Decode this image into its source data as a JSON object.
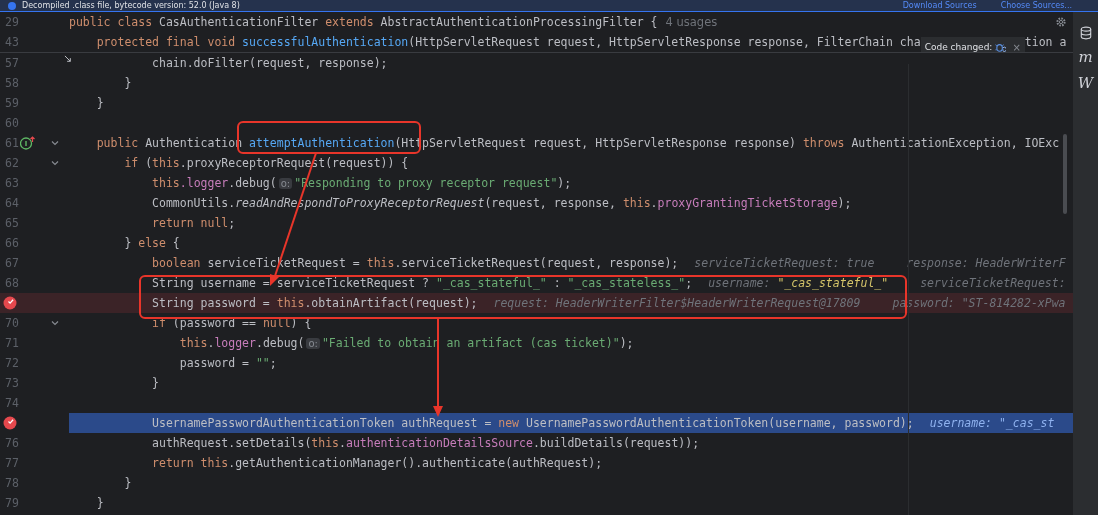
{
  "banner": {
    "text": "Decompiled .class file, bytecode version: 52.0 (Java 8)",
    "links": [
      "Download Sources",
      "Choose Sources..."
    ]
  },
  "side_tools": [
    {
      "kind": "database"
    },
    {
      "kind": "letter",
      "label": "m"
    },
    {
      "kind": "letter",
      "label": "W"
    }
  ],
  "sticky_lines": [
    {
      "open": {
        "number": "29",
        "fold": false,
        "segments": [
          {
            "kind": "code",
            "parts": [
              {
                "t": "public class ",
                "kind": "kw"
              },
              {
                "t": "CasAuthenticationFilter ",
                "kind": "p"
              },
              {
                "t": "extends ",
                "kind": "kw"
              },
              {
                "t": "AbstractAuthenticationProcessingFilter {",
                "kind": "p"
              }
            ]
          },
          {
            "kind": "usage",
            "text": "4 usages"
          },
          {
            "kind": "gear"
          }
        ]
      },
      "children": [
        {
          "number": "43",
          "fold": false,
          "segments": [
            {
              "kind": "code",
              "parts": [
                {
                  "t": "protected final void ",
                  "kind": "kw"
                },
                {
                  "t": "successfulAuthentication",
                  "kind": "fn"
                },
                {
                  "t": "(HttpServletRequest request, HttpServletResponse response, FilterChain cha",
                  "kind": "p"
                }
              ]
            },
            {
              "kind": "popup",
              "text": "Code changed:",
              "close": "×"
            },
            {
              "kind": "code",
              "parts": [
                {
                  "t": "tion a",
                  "kind": "p"
                }
              ]
            }
          ]
        }
      ]
    }
  ],
  "lines": [
    {
      "children": [
        {
          "children": [
            {
              "number": "57",
              "fold": false,
              "gutter": {
                "kind": "step"
              },
              "segments": [
                {
                  "kind": "code",
                  "parts": [
                    {
                      "t": "chain.doFilter(request, response);",
                      "kind": "p"
                    }
                  ]
                }
              ]
            }
          ],
          "close": {
            "number": "58",
            "fold": false,
            "segments": [
              {
                "kind": "code",
                "parts": [
                  {
                    "t": "}",
                    "kind": "p"
                  }
                ]
              }
            ]
          }
        }
      ],
      "close": {
        "number": "59",
        "fold": false,
        "segments": [
          {
            "kind": "code",
            "parts": [
              {
                "t": "}",
                "kind": "p"
              }
            ]
          }
        ]
      }
    },
    {
      "number": "60",
      "fold": false
    },
    {
      "open": {
        "number": "61",
        "fold": true,
        "gutter": {
          "kind": "implements"
        },
        "segments": [
          {
            "kind": "code",
            "parts": [
              {
                "t": "public ",
                "kind": "kw"
              },
              {
                "t": "Authentication ",
                "kind": "p"
              },
              {
                "t": "attemptAuthentication",
                "kind": "fn"
              },
              {
                "t": "(HttpServletRequest request, HttpServletResponse response) ",
                "kind": "p"
              },
              {
                "t": "throws ",
                "kind": "kw"
              },
              {
                "t": "AuthenticationException, IOExc",
                "kind": "p"
              }
            ]
          }
        ]
      },
      "children": [
        {
          "open": {
            "number": "62",
            "fold": true,
            "segments": [
              {
                "kind": "code",
                "parts": [
                  {
                    "t": "if ",
                    "kind": "kw"
                  },
                  {
                    "t": "(",
                    "kind": "p"
                  },
                  {
                    "t": "this",
                    "kind": "kw"
                  },
                  {
                    "t": ".proxyReceptorRequest(request)) {",
                    "kind": "p"
                  }
                ]
              }
            ]
          },
          "children": [
            {
              "number": "63",
              "fold": false,
              "segments": [
                {
                  "kind": "code",
                  "parts": [
                    {
                      "t": "this",
                      "kind": "kw"
                    },
                    {
                      "t": ".logger",
                      "kind": "fld"
                    },
                    {
                      "t": ".debug(",
                      "kind": "p"
                    }
                  ]
                },
                {
                  "kind": "hint",
                  "text": "o:"
                },
                {
                  "kind": "code",
                  "parts": [
                    {
                      "t": "\"Responding to proxy receptor request\"",
                      "kind": "str"
                    },
                    {
                      "t": ");",
                      "kind": "p"
                    }
                  ]
                }
              ]
            },
            {
              "number": "64",
              "fold": false,
              "segments": [
                {
                  "kind": "code",
                  "parts": [
                    {
                      "t": "CommonUtils.",
                      "kind": "p"
                    },
                    {
                      "t": "readAndRespondToProxyReceptorRequest",
                      "kind": "it"
                    },
                    {
                      "t": "(request, response, ",
                      "kind": "p"
                    },
                    {
                      "t": "this",
                      "kind": "kw"
                    },
                    {
                      "t": ".",
                      "kind": "p"
                    },
                    {
                      "t": "proxyGrantingTicketStorage",
                      "kind": "fld"
                    },
                    {
                      "t": ");",
                      "kind": "p"
                    }
                  ]
                }
              ]
            },
            {
              "number": "65",
              "fold": false,
              "segments": [
                {
                  "kind": "code",
                  "parts": [
                    {
                      "t": "return null",
                      "kind": "kw"
                    },
                    {
                      "t": ";",
                      "kind": "p"
                    }
                  ]
                }
              ]
            }
          ],
          "close": {
            "number": "66",
            "fold": false,
            "segments": [
              {
                "kind": "code",
                "parts": [
                  {
                    "t": "} ",
                    "kind": "p"
                  },
                  {
                    "t": "else",
                    "kind": "kw"
                  },
                  {
                    "t": " {",
                    "kind": "p"
                  }
                ]
              }
            ]
          }
        },
        {
          "children": [
            {
              "number": "67",
              "fold": false,
              "segments": [
                {
                  "kind": "code",
                  "parts": [
                    {
                      "t": "boolean ",
                      "kind": "kw"
                    },
                    {
                      "t": "serviceTicketRequest = ",
                      "kind": "p"
                    },
                    {
                      "t": "this",
                      "kind": "kw"
                    },
                    {
                      "t": ".serviceTicketRequest(request, response);",
                      "kind": "p"
                    }
                  ]
                },
                {
                  "kind": "debug",
                  "parts": [
                    {
                      "t": "serviceTicketRequest: true",
                      "kind": "dk"
                    }
                  ]
                },
                {
                  "kind": "debug",
                  "parts": [
                    {
                      "t": "response: HeaderWriterF",
                      "kind": "dk"
                    }
                  ]
                }
              ]
            },
            {
              "number": "68",
              "fold": false,
              "segments": [
                {
                  "kind": "code",
                  "parts": [
                    {
                      "t": "String username = serviceTicketRequest ? ",
                      "kind": "p"
                    },
                    {
                      "t": "\"_cas_stateful_\"",
                      "kind": "str"
                    },
                    {
                      "t": " : ",
                      "kind": "p"
                    },
                    {
                      "t": "\"_cas_stateless_\"",
                      "kind": "str"
                    },
                    {
                      "t": ";",
                      "kind": "p"
                    }
                  ]
                },
                {
                  "kind": "debug",
                  "parts": [
                    {
                      "t": "username: ",
                      "kind": "dk"
                    },
                    {
                      "t": "\"_cas_stateful_\"",
                      "kind": "dv"
                    }
                  ]
                },
                {
                  "kind": "debug",
                  "parts": [
                    {
                      "t": "serviceTicketRequest:",
                      "kind": "dk"
                    }
                  ]
                }
              ]
            },
            {
              "breakpoint": true,
              "current": false,
              "fold": false,
              "segments": [
                {
                  "kind": "code",
                  "parts": [
                    {
                      "t": "String password = ",
                      "kind": "p"
                    },
                    {
                      "t": "this",
                      "kind": "kw"
                    },
                    {
                      "t": ".obtainArtifact(request);",
                      "kind": "p"
                    }
                  ]
                },
                {
                  "kind": "debug",
                  "parts": [
                    {
                      "t": "request: HeaderWriterFilter$HeaderWriterRequest@17809",
                      "kind": "dk"
                    }
                  ]
                },
                {
                  "kind": "debug",
                  "parts": [
                    {
                      "t": "password: \"ST-814282-xPwa",
                      "kind": "dk"
                    }
                  ]
                }
              ]
            },
            {
              "open": {
                "number": "70",
                "fold": true,
                "segments": [
                  {
                    "kind": "code",
                    "parts": [
                      {
                        "t": "if ",
                        "kind": "kw"
                      },
                      {
                        "t": "(password == ",
                        "kind": "p"
                      },
                      {
                        "t": "null",
                        "kind": "kw"
                      },
                      {
                        "t": ") {",
                        "kind": "p"
                      }
                    ]
                  }
                ]
              },
              "children": [
                {
                  "number": "71",
                  "fold": false,
                  "segments": [
                    {
                      "kind": "code",
                      "parts": [
                        {
                          "t": "this",
                          "kind": "kw"
                        },
                        {
                          "t": ".",
                          "kind": "p"
                        },
                        {
                          "t": "logger",
                          "kind": "fld"
                        },
                        {
                          "t": ".debug(",
                          "kind": "p"
                        }
                      ]
                    },
                    {
                      "kind": "hint",
                      "text": "o:"
                    },
                    {
                      "kind": "code",
                      "parts": [
                        {
                          "t": "\"Failed to obtain an artifact (cas ticket)\"",
                          "kind": "str"
                        },
                        {
                          "t": ");",
                          "kind": "p"
                        }
                      ]
                    }
                  ]
                },
                {
                  "number": "72",
                  "fold": false,
                  "segments": [
                    {
                      "kind": "code",
                      "parts": [
                        {
                          "t": "password = ",
                          "kind": "p"
                        },
                        {
                          "t": "\"\"",
                          "kind": "str"
                        },
                        {
                          "t": ";",
                          "kind": "p"
                        }
                      ]
                    }
                  ]
                }
              ],
              "close": {
                "number": "73",
                "fold": false,
                "segments": [
                  {
                    "kind": "code",
                    "parts": [
                      {
                        "t": "}",
                        "kind": "p"
                      }
                    ]
                  }
                ]
              }
            },
            {
              "number": "74",
              "fold": false
            },
            {
              "breakpoint": true,
              "current": true,
              "fold": false,
              "segments": [
                {
                  "kind": "code",
                  "parts": [
                    {
                      "t": "UsernamePasswordAuthenticationToken authRequest = ",
                      "kind": "p"
                    },
                    {
                      "t": "new ",
                      "kind": "kw"
                    },
                    {
                      "t": "UsernamePasswordAuthenticationToken(username, password);",
                      "kind": "p"
                    }
                  ]
                },
                {
                  "kind": "debug",
                  "parts": [
                    {
                      "t": "username: \"_cas_st",
                      "kind": "dk"
                    }
                  ]
                }
              ]
            },
            {
              "number": "76",
              "fold": false,
              "segments": [
                {
                  "kind": "code",
                  "parts": [
                    {
                      "t": "authRequest.setDetails(",
                      "kind": "p"
                    },
                    {
                      "t": "this",
                      "kind": "kw"
                    },
                    {
                      "t": ".",
                      "kind": "p"
                    },
                    {
                      "t": "authenticationDetailsSource",
                      "kind": "fld"
                    },
                    {
                      "t": ".buildDetails(request));",
                      "kind": "p"
                    }
                  ]
                }
              ]
            },
            {
              "number": "77",
              "fold": false,
              "segments": [
                {
                  "kind": "code",
                  "parts": [
                    {
                      "t": "return this",
                      "kind": "kw"
                    },
                    {
                      "t": ".getAuthenticationManager().authenticate(authRequest);",
                      "kind": "p"
                    }
                  ]
                }
              ]
            }
          ],
          "close": {
            "number": "78",
            "fold": false,
            "segments": [
              {
                "kind": "code",
                "parts": [
                  {
                    "t": "}",
                    "kind": "p"
                  }
                ]
              }
            ]
          }
        }
      ],
      "close": {
        "number": "79",
        "fold": false,
        "segments": [
          {
            "kind": "code",
            "parts": [
              {
                "t": "}",
                "kind": "p"
              }
            ]
          }
        ]
      }
    }
  ]
}
